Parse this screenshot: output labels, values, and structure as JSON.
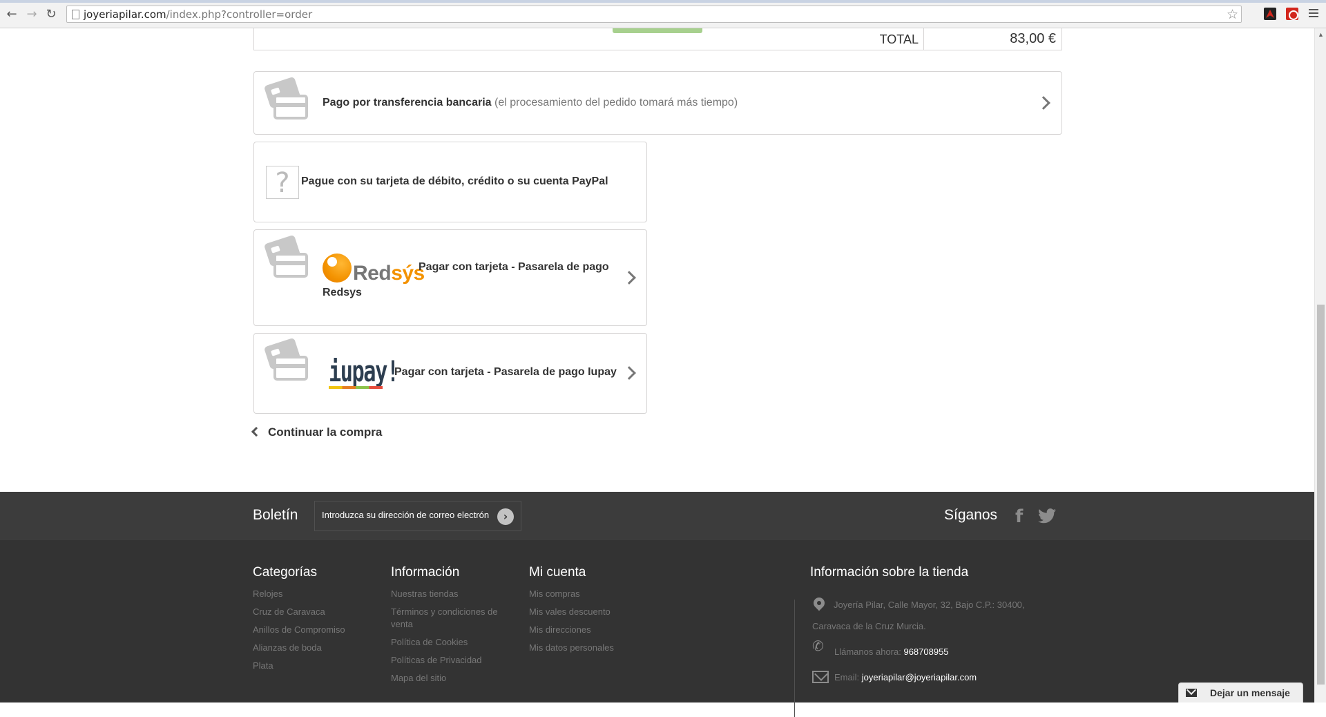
{
  "browser": {
    "url_host": "joyeriapilar.com",
    "url_path": "/index.php?controller=order"
  },
  "summary": {
    "total_label": "TOTAL",
    "total_value": "83,00 €"
  },
  "payments": {
    "bankwire": {
      "label": "Pago por transferencia bancaria",
      "note": "(el procesamiento del pedido tomará más tiempo)"
    },
    "paypal": {
      "label": "Pague con su tarjeta de débito, crédito o su cuenta PayPal"
    },
    "redsys": {
      "logo_text_main": "Red",
      "logo_text_accent": "sýs",
      "label_line1": "Pagar con tarjeta - Pasarela de pago",
      "label_line2": "Redsys"
    },
    "iupay": {
      "logo_text": "iupay!",
      "label": "Pagar con tarjeta - Pasarela de pago Iupay"
    }
  },
  "continue_label": "Continuar la compra",
  "footer": {
    "newsletter_title": "Boletín",
    "newsletter_placeholder": "Introduzca su dirección de correo electrón",
    "follow_title": "Síganos",
    "categories": {
      "title": "Categorías",
      "items": [
        "Relojes",
        "Cruz de Caravaca",
        "Anillos de Compromiso",
        "Alianzas de boda",
        "Plata"
      ]
    },
    "information": {
      "title": "Información",
      "items": [
        "Nuestras tiendas",
        "Términos y condiciones de venta",
        "Política de Cookies",
        "Políticas de Privacidad",
        "Mapa del sitio"
      ]
    },
    "account": {
      "title": "Mi cuenta",
      "items": [
        "Mis compras",
        "Mis vales descuento",
        "Mis direcciones",
        "Mis datos personales"
      ]
    },
    "store": {
      "title": "Información sobre la tienda",
      "address_line1": "Joyería Pilar, Calle Mayor, 32, Bajo C.P.: 30400,",
      "address_line2": "Caravaca de la Cruz Murcia.",
      "phone_label": "Llámanos ahora:",
      "phone_value": "968708955",
      "email_label": "Email:",
      "email_value": "joyeriapilar@joyeriapilar.com"
    }
  },
  "chat_label": "Dejar un mensaje"
}
